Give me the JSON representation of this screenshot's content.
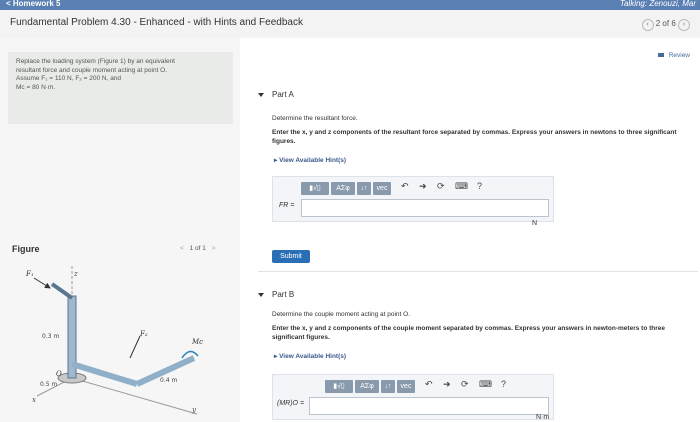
{
  "topbar": {
    "back_label": "< Homework 5",
    "user_label": "Talking: Zenouzi, Mar"
  },
  "header": {
    "title": "Fundamental Problem 4.30 - Enhanced - with Hints and Feedback",
    "pager": "2 of 6",
    "prev_icon": "chevron-left-icon",
    "next_icon": "chevron-right-icon"
  },
  "problem": {
    "line1": "Replace the loading system (Figure 1) by an equivalent",
    "line2": "resultant force and couple moment acting at point O.",
    "line3": "Assume F₁ = 110 N, F₂ = 200 N, and",
    "line4": "Mc = 80 N·m."
  },
  "figure": {
    "heading": "Figure",
    "nav": "1 of 1",
    "labels": {
      "f1": "F₁",
      "mc": "Mc",
      "f2": "F₂",
      "d1": "0.3 m",
      "d2": "0.5 m",
      "d3": "0.4 m",
      "o": "O",
      "x": "x",
      "y": "y",
      "z": "z"
    }
  },
  "review_label": "Review",
  "partA": {
    "title": "Part A",
    "desc": "Determine the resultant force.",
    "instr": "Enter the x, y and z components of the resultant force separated by commas. Express your answers in newtons to three significant figures.",
    "hint": "View Available Hint(s)",
    "answer_label": "FR =",
    "answer_value": "",
    "unit": "N",
    "submit": "Submit"
  },
  "partB": {
    "title": "Part B",
    "desc": "Determine the couple moment acting at point O.",
    "instr": "Enter the x, y and z components of the couple moment separated by commas. Express your answers in newton-meters to three significant figures.",
    "hint": "View Available Hint(s)",
    "answer_label": "(MR)O =",
    "answer_value": "",
    "unit": "N·m"
  },
  "toolbar": {
    "templates": "▮√▯",
    "greek": "ΑΣφ",
    "arrows": "↓↑",
    "vec": "vec",
    "undo_icon": "undo-icon",
    "redo_icon": "redo-icon",
    "reset_icon": "reset-icon",
    "keyboard_icon": "keyboard-icon",
    "help": "?"
  }
}
